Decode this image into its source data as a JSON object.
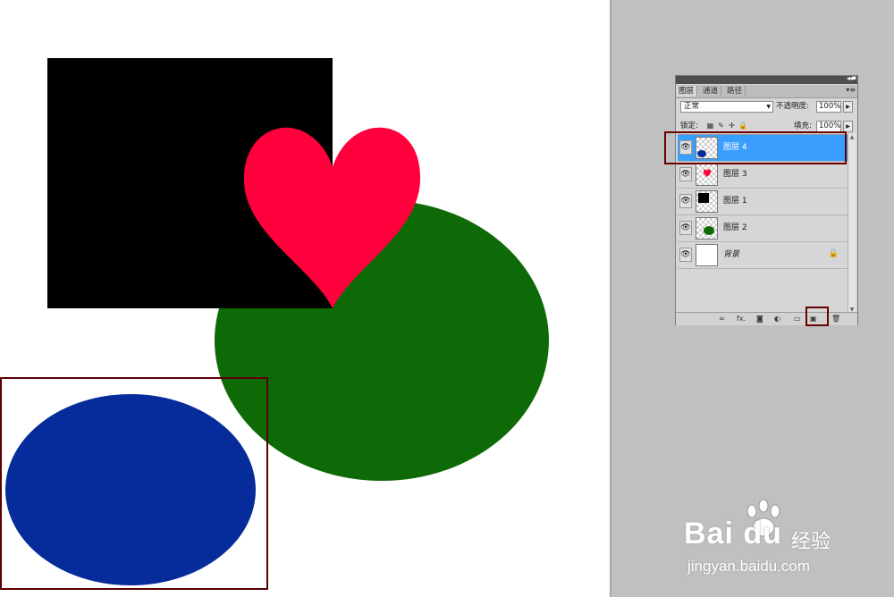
{
  "layers_panel": {
    "tabs": [
      "图层",
      "通道",
      "路径"
    ],
    "blend_mode": "正常",
    "opacity_label": "不透明度:",
    "opacity_value": "100%",
    "lock_label": "锁定:",
    "fill_label": "填充:",
    "fill_value": "100%",
    "layers": [
      {
        "name": "图层 4",
        "selected": true,
        "thumbnail": "blue-ellipse"
      },
      {
        "name": "图层 3",
        "selected": false,
        "thumbnail": "red-heart"
      },
      {
        "name": "图层 1",
        "selected": false,
        "thumbnail": "black-square"
      },
      {
        "name": "图层 2",
        "selected": false,
        "thumbnail": "green-ellipse"
      },
      {
        "name": "背景",
        "selected": false,
        "thumbnail": "white-background",
        "locked": true
      }
    ],
    "footer_icons": [
      "link-layers-icon",
      "fx-icon",
      "layer-mask-icon",
      "adjustment-layer-icon",
      "new-group-icon",
      "new-layer-icon",
      "delete-layer-icon"
    ],
    "footer_fx_text": "fx."
  },
  "canvas": {
    "colors": {
      "black_square": "#000000",
      "red_heart": "#ff003c",
      "green_ellipse": "#0d6a06",
      "blue_ellipse": "#062b9a"
    }
  },
  "watermark": {
    "brand": "Bai du",
    "sub": "经验",
    "url": "jingyan.baidu.com"
  }
}
